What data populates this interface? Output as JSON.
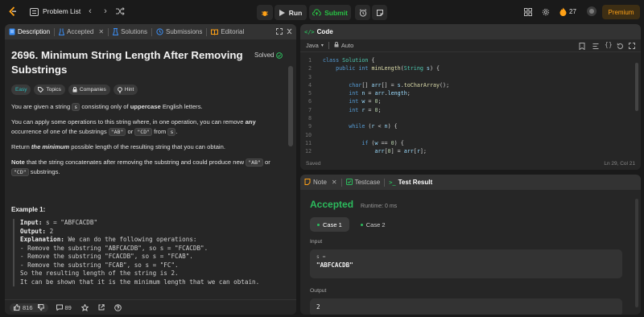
{
  "topbar": {
    "problem_list": "Problem List",
    "run": "Run",
    "submit": "Submit",
    "streak": "27",
    "premium": "Premium"
  },
  "left": {
    "tabs": {
      "description": "Description",
      "accepted": "Accepted",
      "solutions": "Solutions",
      "submissions": "Submissions",
      "editorial": "Editorial"
    },
    "title": "2696. Minimum String Length After Removing Substrings",
    "solved": "Solved",
    "tags": {
      "difficulty": "Easy",
      "topics": "Topics",
      "companies": "Companies",
      "hint": "Hint"
    },
    "p1": {
      "a": "You are given a string ",
      "code": "s",
      "b": " consisting only of ",
      "bold": "uppercase",
      "c": " English letters."
    },
    "p2": {
      "a": "You can apply some operations to this string where, in one operation, you can remove ",
      "bold": "any",
      "b": " occurrence of one of the substrings ",
      "code1": "\"AB\"",
      "c": " or ",
      "code2": "\"CD\"",
      "d": " from ",
      "code3": "s",
      "e": "."
    },
    "p3": {
      "a": "Return ",
      "bold": "the minimum",
      "b": " possible length of the resulting string that you can obtain."
    },
    "p4": {
      "bold": "Note",
      "a": " that the string concatenates after removing the substring and could produce new ",
      "code1": "\"AB\"",
      "b": " or ",
      "code2": "\"CD\"",
      "c": " substrings."
    },
    "example_heading": "Example 1:",
    "example": {
      "input_label": "Input:",
      "input_value": " s = \"ABFCACDB\"",
      "output_label": "Output:",
      "output_value": " 2",
      "explanation_label": "Explanation:",
      "explanation_value": " We can do the following operations:",
      "lines": [
        "- Remove the substring \"ABFCACDB\", so s = \"FCACDB\".",
        "- Remove the substring \"FCACDB\", so s = \"FCAB\".",
        "- Remove the substring \"FCAB\", so s = \"FC\".",
        "So the resulting length of the string is 2.",
        "It can be shown that it is the minimum length that we can obtain."
      ]
    },
    "footer": {
      "likes": "816",
      "comments": "89"
    }
  },
  "code": {
    "tab": "Code",
    "language": "Java",
    "auto": "Auto",
    "status": "Saved",
    "cursor": "Ln 29, Col 21",
    "line_numbers": [
      "1",
      "2",
      "3",
      "4",
      "5",
      "6",
      "7",
      "8",
      "9",
      "10",
      "11",
      "12"
    ]
  },
  "result": {
    "tabs": {
      "note": "Note",
      "testcase": "Testcase",
      "result": "Test Result"
    },
    "verdict": "Accepted",
    "runtime": "Runtime: 0 ms",
    "cases": [
      "Case 1",
      "Case 2"
    ],
    "input_label": "Input",
    "var_name": "s =",
    "input_value": "\"ABFCACDB\"",
    "output_label": "Output",
    "output_value": "2"
  },
  "colors": {
    "accent": "#ffa116",
    "accepted": "#2cbb5d",
    "submit": "#28c244"
  }
}
